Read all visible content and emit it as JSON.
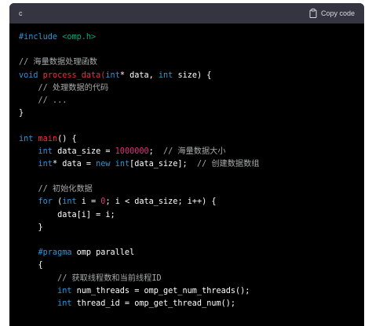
{
  "header": {
    "language": "c",
    "copy_label": "Copy code"
  },
  "code": {
    "l1_a": "#include",
    "l1_b": " <omp.h>",
    "l3": "// 海量数据处理函数",
    "l4_a": "void",
    "l4_b": " process_data",
    "l4_c": "(",
    "l4_d": "int",
    "l4_e": "* data, ",
    "l4_f": "int",
    "l4_g": " size) {",
    "l5": "    // 处理数据的代码",
    "l6": "    // ...",
    "l7": "}",
    "l9_a": "int",
    "l9_b": " main",
    "l9_c": "() {",
    "l10_a": "    int",
    "l10_b": " data_size = ",
    "l10_c": "1000000",
    "l10_d": ";  ",
    "l10_e": "// 海量数据大小",
    "l11_a": "    int",
    "l11_b": "* data = ",
    "l11_c": "new",
    "l11_d": " ",
    "l11_e": "int",
    "l11_f": "[data_size];  ",
    "l11_g": "// 创建数据数组",
    "l13": "    // 初始化数据",
    "l14_a": "    for",
    "l14_b": " (",
    "l14_c": "int",
    "l14_d": " i = ",
    "l14_e": "0",
    "l14_f": "; i < data_size; i++) {",
    "l15": "        data[i] = i;",
    "l16": "    }",
    "l18_a": "    #pragma",
    "l18_b": " omp parallel",
    "l19": "    {",
    "l20": "        // 获取线程数和当前线程ID",
    "l21_a": "        int",
    "l21_b": " num_threads = omp_get_num_threads();",
    "l22_a": "        int",
    "l22_b": " thread_id = omp_get_thread_num();"
  },
  "colors": {
    "keyword": "#2e95d3",
    "string": "#00a67d",
    "function": "#f22c3d",
    "number": "#df3079",
    "comment": "#a9aaab",
    "background": "#000000",
    "header_bg": "#343541"
  }
}
